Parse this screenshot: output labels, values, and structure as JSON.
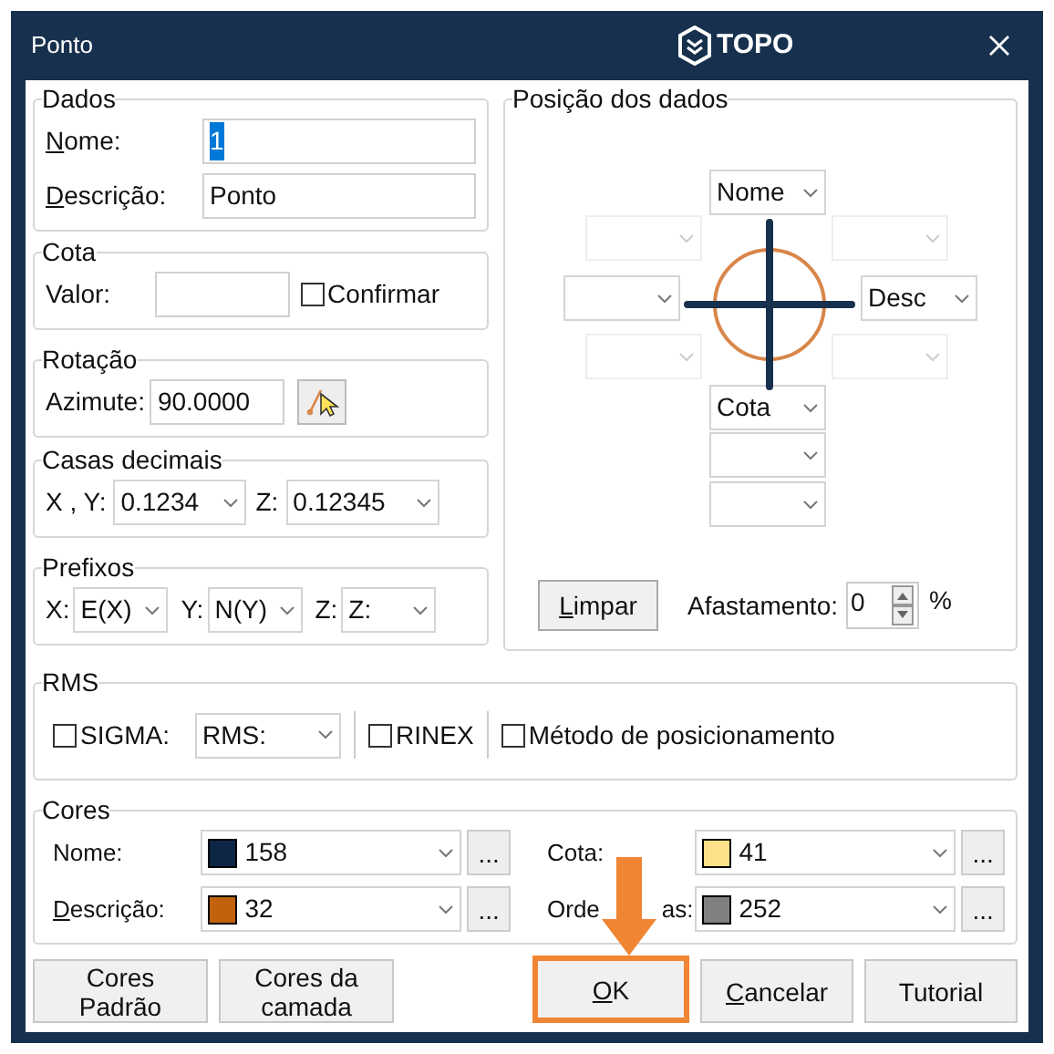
{
  "window": {
    "title": "Ponto",
    "logo_text": "TOPO"
  },
  "dados": {
    "legend": "Dados",
    "nome_label": {
      "text": "Nome:",
      "accel": true
    },
    "nome_value": "1",
    "nome_selected": true,
    "descricao_label": {
      "text": "Descrição:",
      "accel": true
    },
    "descricao_value": "Ponto"
  },
  "cota": {
    "legend": "Cota",
    "valor_label": "Valor:",
    "confirmar": {
      "label": "Confirmar",
      "checked": false
    }
  },
  "rotacao": {
    "legend": "Rotação",
    "azimute_label": "Azimute:",
    "azimute_value": "90.0000"
  },
  "casas_decimais": {
    "legend": "Casas decimais",
    "xy_label": "X , Y:",
    "xy_value": "0.1234",
    "z_label": "Z:",
    "z_value": "0.12345"
  },
  "prefixos": {
    "legend": "Prefixos",
    "items": [
      {
        "label": "X:",
        "value": "E(X)"
      },
      {
        "label": "Y:",
        "value": "N(Y)"
      },
      {
        "label": "Z:",
        "value": "Z:"
      }
    ]
  },
  "posicao": {
    "legend": "Posição dos dados",
    "slots": {
      "top": {
        "value": "Nome",
        "disabled": false
      },
      "upper_left": {
        "disabled": true
      },
      "upper_right": {
        "disabled": true
      },
      "left": {
        "disabled": false
      },
      "right": {
        "value": "Desc",
        "disabled": false
      },
      "lower_left": {
        "disabled": true
      },
      "lower_right": {
        "disabled": true
      },
      "bottom": {
        "value": "Cota",
        "disabled": false
      },
      "bottom_2": {
        "disabled": false
      },
      "bottom_3": {
        "disabled": false
      }
    },
    "limpar": {
      "text": "Limpar",
      "accel": true
    },
    "afastamento_label": "Afastamento:",
    "afastamento_value": "0",
    "percent": "%"
  },
  "rms": {
    "legend": "RMS",
    "sigma": {
      "label": "SIGMA:",
      "checked": false
    },
    "rms_value": "RMS:",
    "rinex": {
      "label": "RINEX",
      "checked": false
    },
    "metodo": {
      "label": "Método de posicionamento",
      "checked": false
    }
  },
  "cores": {
    "legend": "Cores",
    "items": [
      {
        "label": {
          "text": "Nome:",
          "accel": false
        },
        "value": "158",
        "color": "#0d2646",
        "more": "..."
      },
      {
        "label": {
          "text": "Cota:",
          "accel": false
        },
        "value": "41",
        "color": "#ffe08a",
        "more": "..."
      },
      {
        "label": {
          "text": "Descrição:",
          "accel": true
        },
        "value": "32",
        "color": "#c2620a",
        "more": "..."
      },
      {
        "label": {
          "text": "Orde",
          "accel": false,
          "tail": "as:"
        },
        "value": "252",
        "color": "#808080",
        "more": "..."
      }
    ]
  },
  "left_buttons": [
    {
      "text": "Cores Padrão",
      "accel": false,
      "highlighted": false
    },
    {
      "text": "Cores da camada",
      "accel": false,
      "highlighted": false
    }
  ],
  "right_buttons": [
    {
      "text": "OK",
      "accel": true,
      "highlighted": true
    },
    {
      "text": "Cancelar",
      "accel": true,
      "highlighted": false
    },
    {
      "text": "Tutorial",
      "accel": false,
      "highlighted": false
    }
  ]
}
